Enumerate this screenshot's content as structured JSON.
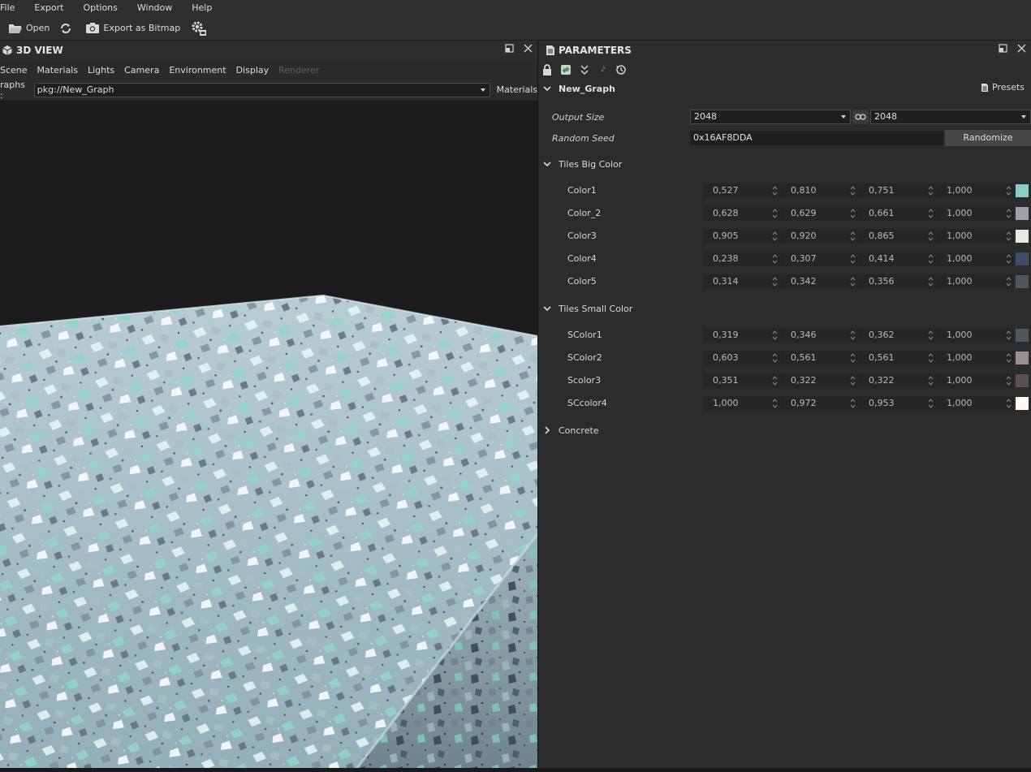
{
  "menu": [
    "File",
    "Export",
    "Options",
    "Window",
    "Help"
  ],
  "toolbar": {
    "open_label": "Open",
    "export_label": "Export as Bitmap"
  },
  "view": {
    "title": "3D VIEW",
    "menu": [
      "Scene",
      "Materials",
      "Lights",
      "Camera",
      "Environment",
      "Display",
      "Renderer"
    ],
    "graphs_label": "raphs :",
    "graph_value": "pkg://New_Graph",
    "materials_label": "Materials"
  },
  "params": {
    "title": "PARAMETERS",
    "graph_name": "New_Graph",
    "presets_label": "Presets",
    "output_size_label": "Output Size",
    "output_size_w": "2048",
    "output_size_h": "2048",
    "random_seed_label": "Random Seed",
    "random_seed_value": "0x16AF8DDA",
    "randomize_label": "Randomize",
    "groups": [
      {
        "name": "Tiles Big Color",
        "items": [
          {
            "label": "Color1",
            "v": [
              "0,527",
              "0,810",
              "0,751",
              "1,000"
            ],
            "color": "#86d0c3"
          },
          {
            "label": "Color_2",
            "v": [
              "0,628",
              "0,629",
              "0,661",
              "1,000"
            ],
            "color": "#a0a0a9"
          },
          {
            "label": "Color3",
            "v": [
              "0,905",
              "0,920",
              "0,865",
              "1,000"
            ],
            "color": "#e7eadc"
          },
          {
            "label": "Color4",
            "v": [
              "0,238",
              "0,307",
              "0,414",
              "1,000"
            ],
            "color": "#3d4e69"
          },
          {
            "label": "Color5",
            "v": [
              "0,314",
              "0,342",
              "0,356",
              "1,000"
            ],
            "color": "#50575b"
          }
        ]
      },
      {
        "name": "Tiles Small Color",
        "items": [
          {
            "label": "SColor1",
            "v": [
              "0,319",
              "0,346",
              "0,362",
              "1,000"
            ],
            "color": "#51585c"
          },
          {
            "label": "SColor2",
            "v": [
              "0,603",
              "0,561",
              "0,561",
              "1,000"
            ],
            "color": "#9a8f8f"
          },
          {
            "label": "Scolor3",
            "v": [
              "0,351",
              "0,322",
              "0,322",
              "1,000"
            ],
            "color": "#5a5252"
          },
          {
            "label": "SCcolor4",
            "v": [
              "1,000",
              "0,972",
              "0,953",
              "1,000"
            ],
            "color": "#fff8f3"
          }
        ]
      }
    ],
    "collapsed_group": "Concrete"
  }
}
